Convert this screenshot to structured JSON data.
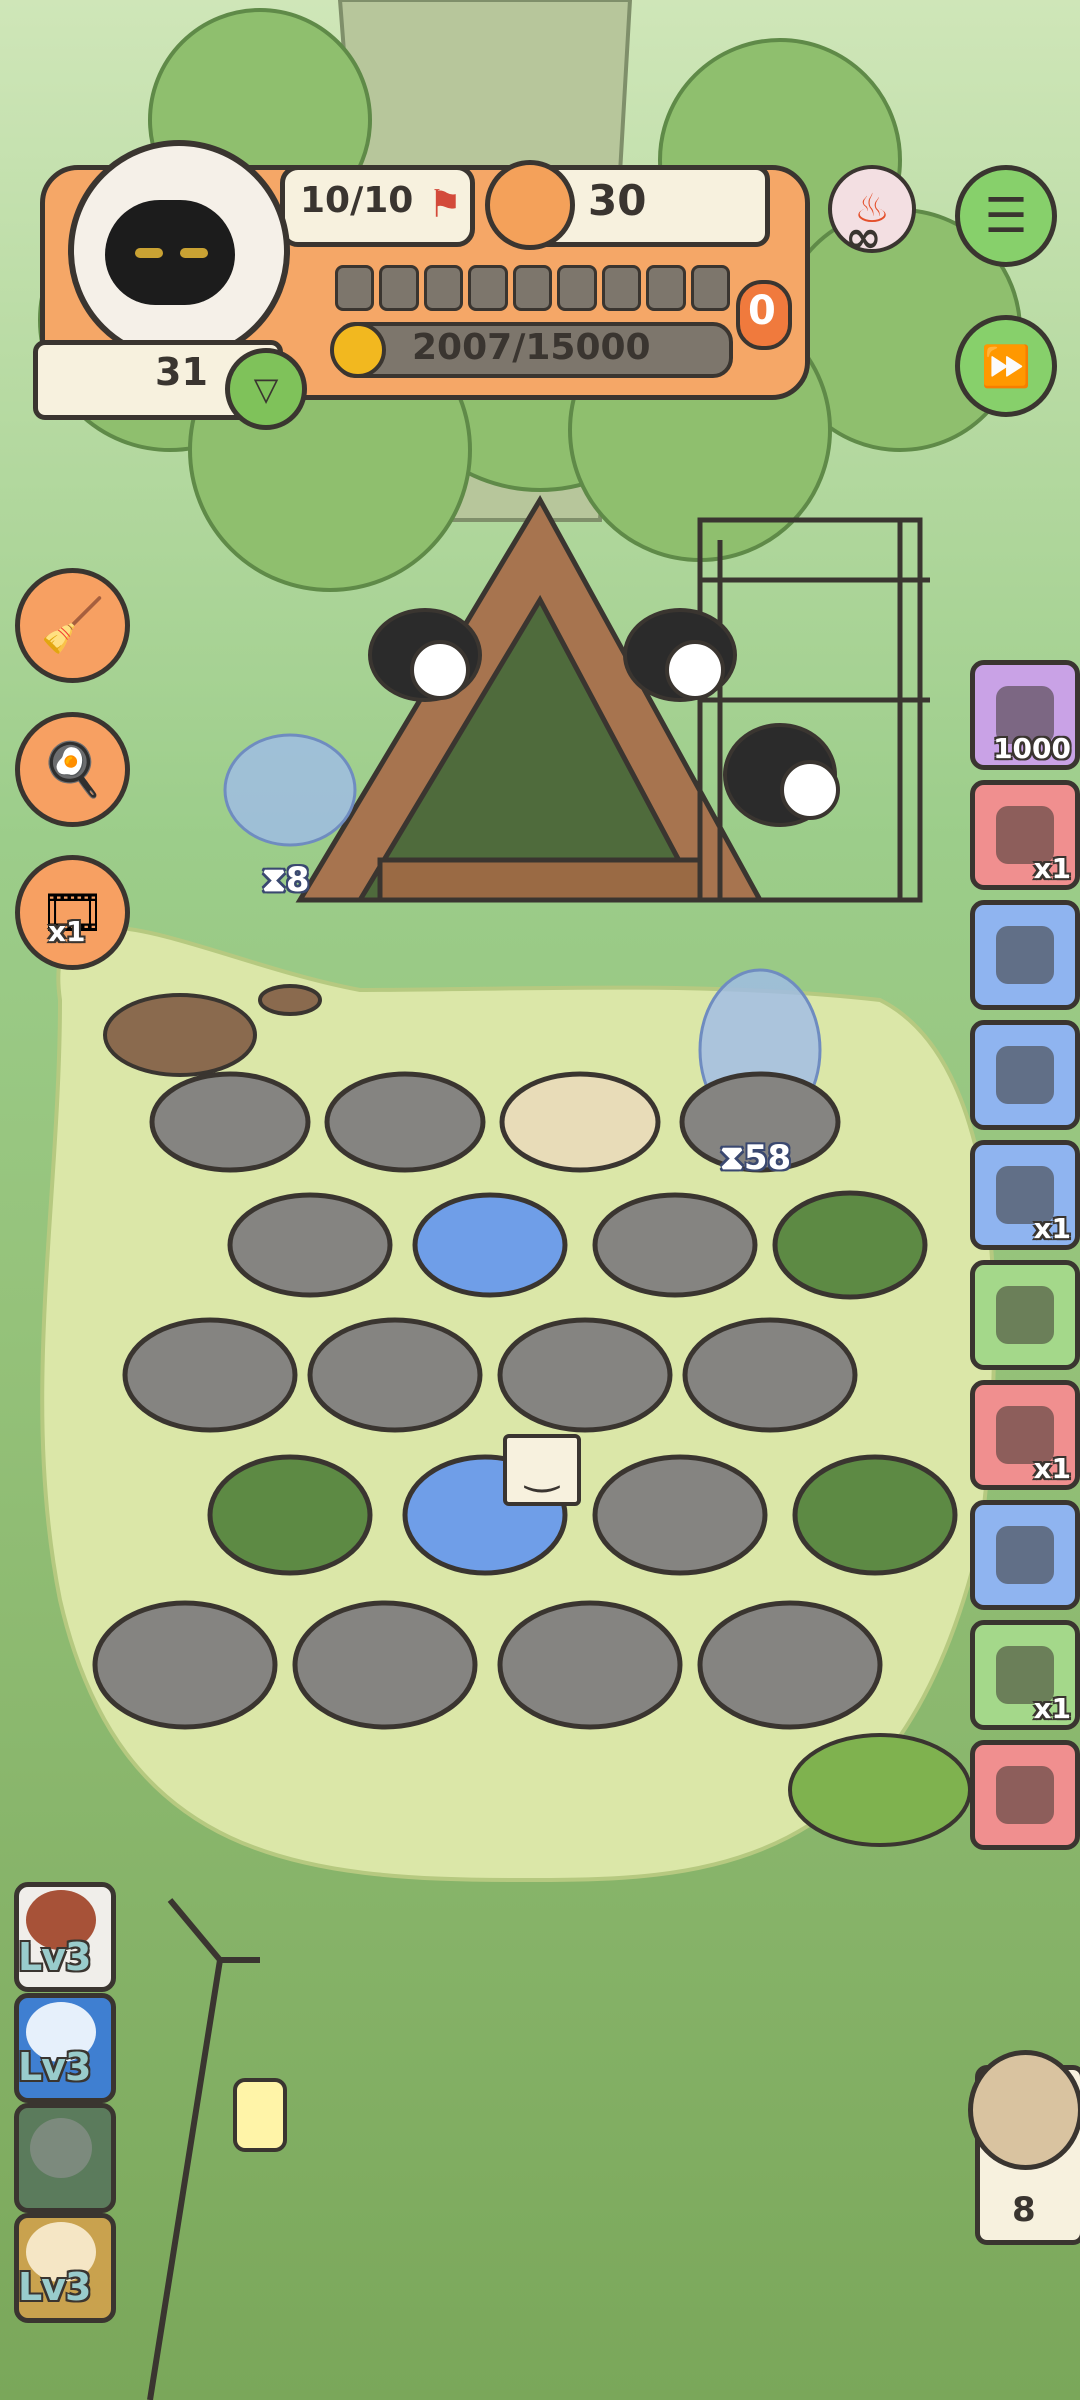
{
  "hud": {
    "energy": "10/10",
    "food_count": "30",
    "player_level_value": "31",
    "coins": "2007/15000",
    "pending_count": "0",
    "infinity_symbol": "∞"
  },
  "camp": {
    "bird_timer_left": "8",
    "bird_timer_right": "58",
    "tooltip_glyph": "‿"
  },
  "left_menu": {
    "item3_qty": "x1"
  },
  "side_items": [
    {
      "icon": "film-reel-icon",
      "qty": "1000",
      "color": "#c9a2e6"
    },
    {
      "icon": "snorkel-mask-icon",
      "qty": "x1",
      "color": "#f08f8f"
    },
    {
      "icon": "easel-icon",
      "qty": "",
      "color": "#8fb4f0"
    },
    {
      "icon": "straw-hut-icon",
      "qty": "",
      "color": "#8fb4f0"
    },
    {
      "icon": "cooking-pot-icon",
      "qty": "x1",
      "color": "#8fb4f0"
    },
    {
      "icon": "fishing-rod-icon",
      "qty": "",
      "color": "#a4d88a"
    },
    {
      "icon": "birdcage-icon",
      "qty": "x1",
      "color": "#f08f8f"
    },
    {
      "icon": "camera-icon",
      "qty": "",
      "color": "#8fb4f0"
    },
    {
      "icon": "helmet-icon",
      "qty": "x1",
      "color": "#a4d88a"
    },
    {
      "icon": "sticker-icon",
      "qty": "",
      "color": "#f08f8f"
    }
  ],
  "level_cards": [
    {
      "label": "Lv3"
    },
    {
      "label": "Lv3"
    },
    {
      "label": ""
    },
    {
      "label": "Lv3"
    }
  ],
  "owl_count": "8"
}
